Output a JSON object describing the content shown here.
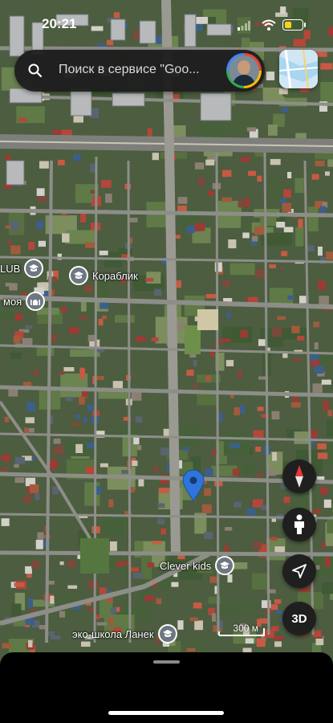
{
  "status_bar": {
    "time": "20:21"
  },
  "search": {
    "placeholder": "Поиск в сервисе \"Goo..."
  },
  "map": {
    "pois": [
      {
        "id": "club",
        "label": "LUB"
      },
      {
        "id": "korablik",
        "label": "Кораблик"
      },
      {
        "id": "moya",
        "label": "моя"
      },
      {
        "id": "clever",
        "label": "Clever kids"
      },
      {
        "id": "eco",
        "label": "эко-школа Ланек"
      }
    ],
    "scale_label": "300 м"
  },
  "controls": {
    "three_d_label": "3D"
  },
  "colors": {
    "pin": "#2f74d9",
    "map_base": "#4a5a3e",
    "button_bg": "#1f1f1f"
  }
}
